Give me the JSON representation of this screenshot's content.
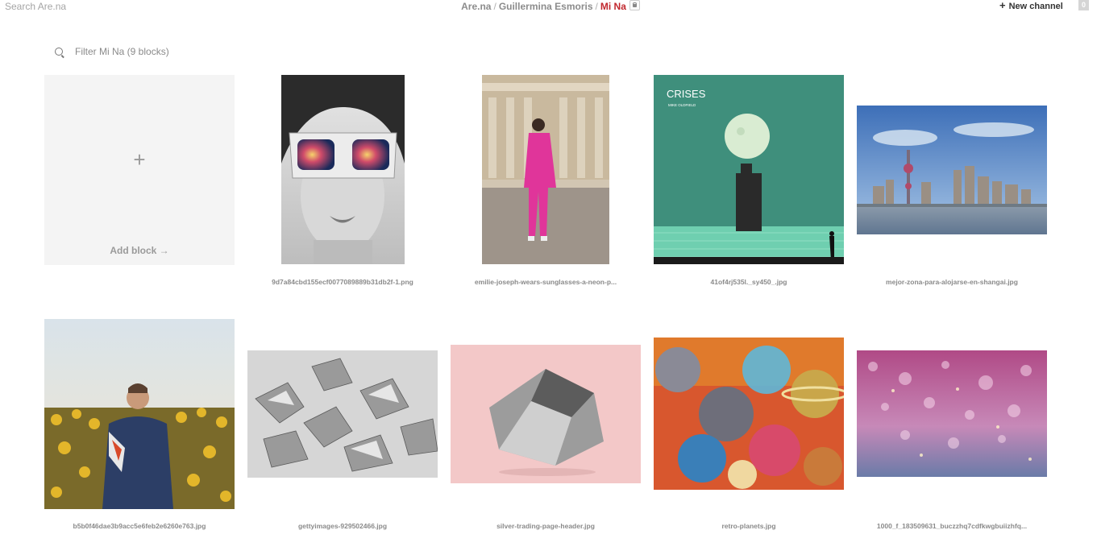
{
  "topbar": {
    "search_placeholder": "Search Are.na",
    "breadcrumb": [
      "Are.na",
      "Guillermina Esmoris",
      "Mi Na"
    ],
    "new_channel_label": "New channel",
    "count": "0"
  },
  "filter": {
    "placeholder": "Filter Mi Na (9 blocks)"
  },
  "add_block": {
    "plus": "+",
    "label": "Add block →"
  },
  "blocks": [
    {
      "caption": "9d7a84cbd155ecf0077089889b31db2f-1.png"
    },
    {
      "caption": "emilie-joseph-wears-sunglasses-a-neon-p..."
    },
    {
      "caption": "41of4rj535l._sy450_.jpg"
    },
    {
      "caption": "mejor-zona-para-alojarse-en-shangai.jpg"
    },
    {
      "caption": "b5b0f46dae3b9acc5e6feb2e6260e763.jpg"
    },
    {
      "caption": "gettyimages-929502466.jpg"
    },
    {
      "caption": "silver-trading-page-header.jpg"
    },
    {
      "caption": "retro-planets.jpg"
    },
    {
      "caption": "1000_f_183509631_buczzhq7cdfkwgbuiizhfq..."
    }
  ],
  "crises_cover": {
    "title": "CRISES",
    "artist": "MIKE OLDFIELD"
  }
}
